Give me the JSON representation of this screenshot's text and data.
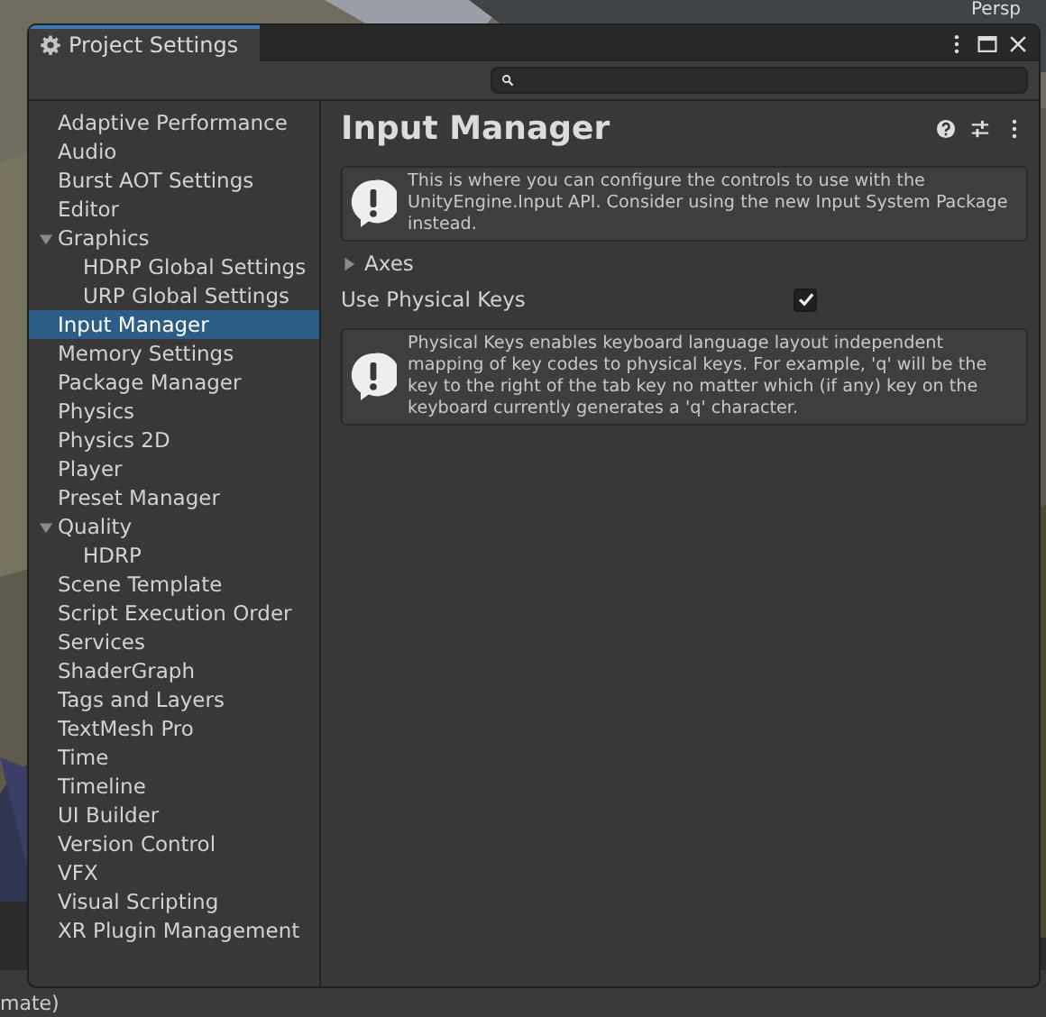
{
  "scene_view": {
    "label": "Persp"
  },
  "status_bar": {
    "text": "mate)"
  },
  "window": {
    "title": "Project Settings"
  },
  "sidebar": {
    "items": [
      {
        "label": "Adaptive Performance",
        "selected": false
      },
      {
        "label": "Audio",
        "selected": false
      },
      {
        "label": "Burst AOT Settings",
        "selected": false
      },
      {
        "label": "Editor",
        "selected": false
      },
      {
        "label": "Graphics",
        "selected": false,
        "expanded": true,
        "children": [
          {
            "label": "HDRP Global Settings",
            "selected": false
          },
          {
            "label": "URP Global Settings",
            "selected": false
          }
        ]
      },
      {
        "label": "Input Manager",
        "selected": true
      },
      {
        "label": "Memory Settings",
        "selected": false
      },
      {
        "label": "Package Manager",
        "selected": false
      },
      {
        "label": "Physics",
        "selected": false
      },
      {
        "label": "Physics 2D",
        "selected": false
      },
      {
        "label": "Player",
        "selected": false
      },
      {
        "label": "Preset Manager",
        "selected": false
      },
      {
        "label": "Quality",
        "selected": false,
        "expanded": true,
        "children": [
          {
            "label": "HDRP",
            "selected": false
          }
        ]
      },
      {
        "label": "Scene Template",
        "selected": false
      },
      {
        "label": "Script Execution Order",
        "selected": false
      },
      {
        "label": "Services",
        "selected": false
      },
      {
        "label": "ShaderGraph",
        "selected": false
      },
      {
        "label": "Tags and Layers",
        "selected": false
      },
      {
        "label": "TextMesh Pro",
        "selected": false
      },
      {
        "label": "Time",
        "selected": false
      },
      {
        "label": "Timeline",
        "selected": false
      },
      {
        "label": "UI Builder",
        "selected": false
      },
      {
        "label": "Version Control",
        "selected": false
      },
      {
        "label": "VFX",
        "selected": false
      },
      {
        "label": "Visual Scripting",
        "selected": false
      },
      {
        "label": "XR Plugin Management",
        "selected": false
      }
    ]
  },
  "page": {
    "title": "Input Manager",
    "fields": [
      {
        "kind": "help",
        "text": "This is where you can configure the controls to use with the UnityEngine.Input API. Consider using the new Input System Package instead."
      },
      {
        "kind": "foldout",
        "label": "Axes",
        "expanded": false
      },
      {
        "kind": "toggle",
        "label": "Use Physical Keys",
        "checked": true
      },
      {
        "kind": "help",
        "text": "Physical Keys enables keyboard language layout independent mapping of key codes to physical keys. For example, 'q' will be the key to the right of the tab key no matter which (if any) key on the keyboard currently generates a 'q' character."
      }
    ]
  }
}
